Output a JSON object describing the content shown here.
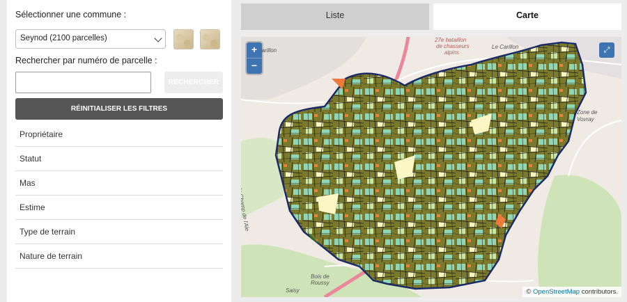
{
  "sidebar": {
    "commune_label": "Sélectionner une commune :",
    "commune_selected": "Seynod (2100 parcelles)",
    "parcel_search_label": "Rechercher par numéro de parcelle :",
    "parcel_search_value": "",
    "search_button": "RECHERCHER",
    "reset_button": "RÉINITIALISER LES FILTRES",
    "filters": [
      "Propriétaire",
      "Statut",
      "Mas",
      "Estime",
      "Type de terrain",
      "Nature de terrain"
    ]
  },
  "tabs": [
    {
      "label": "Liste",
      "active": false
    },
    {
      "label": "Carte",
      "active": true
    }
  ],
  "map": {
    "zoom_in": "+",
    "zoom_out": "−",
    "fullscreen_icon": "⤢",
    "attribution_prefix": "© ",
    "attribution_link": "OpenStreetMap",
    "attribution_suffix": " contributors.",
    "labels": {
      "carillon_w": "Carillon",
      "carillon_e": "Le Carillon",
      "bataillon_1": "27e bataillon",
      "bataillon_2": "de chasseurs",
      "bataillon_3": "alpins",
      "zone_1": "Zone de",
      "zone_2": "Vovray",
      "champ": "du Champ de l'Ale",
      "bois_1": "Bois de",
      "bois_2": "Roussy",
      "saisy": "Saisy"
    },
    "colors": {
      "parcel_olive": "#7b7a2c",
      "parcel_teal": "#8ed6b6",
      "parcel_cream": "#fcf6c4",
      "parcel_lightgreen": "#c7e7a6",
      "parcel_orange": "#ef7a3c",
      "outline": "#1c2b66",
      "road": "#e9889b"
    }
  }
}
